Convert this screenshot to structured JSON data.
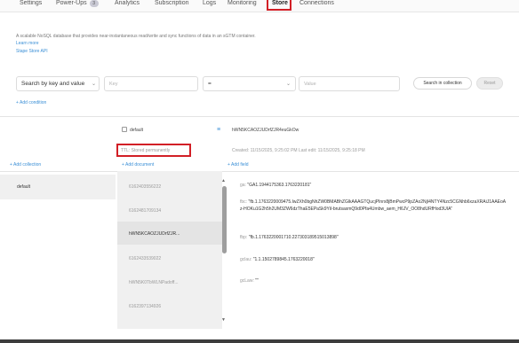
{
  "nav": {
    "tabs": [
      {
        "label": "Settings"
      },
      {
        "label": "Power-Ups",
        "badge": "3"
      },
      {
        "label": "Analytics"
      },
      {
        "label": "Subscription"
      },
      {
        "label": "Logs"
      },
      {
        "label": "Monitoring"
      },
      {
        "label": "Store",
        "active": true
      },
      {
        "label": "Connections"
      }
    ]
  },
  "description": {
    "text": "A scalable NoSQL database that provides near-instantaneous read/write and sync functions of data in an sGTM container.",
    "learn_more": "Learn more",
    "api_link": "Stape Store API"
  },
  "search": {
    "mode_label": "Search by key and value",
    "key_placeholder": "Key",
    "operator_value": "=",
    "value_placeholder": "Value",
    "search_button": "Search in collection",
    "reset_button": "Reset",
    "add_condition": "+ Add condition"
  },
  "collection_header": {
    "name": "default",
    "ttl": "TTL: Stored permanently"
  },
  "document_header": {
    "id": "hWN5KCAOZJUDrfZJR4euGkOw",
    "meta": "Created: 11/15/2025, 9:25:02 PM    Last edit: 11/15/2025, 9:25:18 PM"
  },
  "actions": {
    "add_collection": "+ Add collection",
    "add_document": "+ Add document",
    "add_field": "+ Add field"
  },
  "collections": [
    {
      "name": "default"
    }
  ],
  "documents": [
    {
      "id": "6162403556222"
    },
    {
      "id": "6162481709134"
    },
    {
      "id": "hWN5KCAOZJUDrfZJR...",
      "selected": true
    },
    {
      "id": "6162433539022"
    },
    {
      "id": "hWN5K0TbWLNPadoff..."
    },
    {
      "id": "6162397134926"
    }
  ],
  "fields": [
    {
      "key": "ga:",
      "value": "\"GA1.1944175363.1763220181\""
    },
    {
      "key": "fbc:",
      "value": "\"fb.1.1763220009475.IwZXh0bgNhZW0BMABhZGlkAAAGTQucjPInrx8jBmPwcP9pZAo2NjI4NTY4Nzc5CGNhb6xzaXRAiJ1AAEoAz-HOKu1G2h5h2UM3ZW6dzThaE5EPaSk9YiI-brutsaxmQ9d0Pfa4Umbw_aem_H6JV_OO8hdURfHod3UIA\""
    },
    {
      "key": "fbp:",
      "value": "\"fb.1.1763220001710.227303189515013898\""
    },
    {
      "key": "gclau:",
      "value": "\"1.1.1502789845.1763220018\""
    },
    {
      "key": "gcLaw:",
      "value": "\"\""
    }
  ],
  "colors": {
    "accent_blue": "#3a8fd6",
    "highlight_red": "#d21f26"
  }
}
